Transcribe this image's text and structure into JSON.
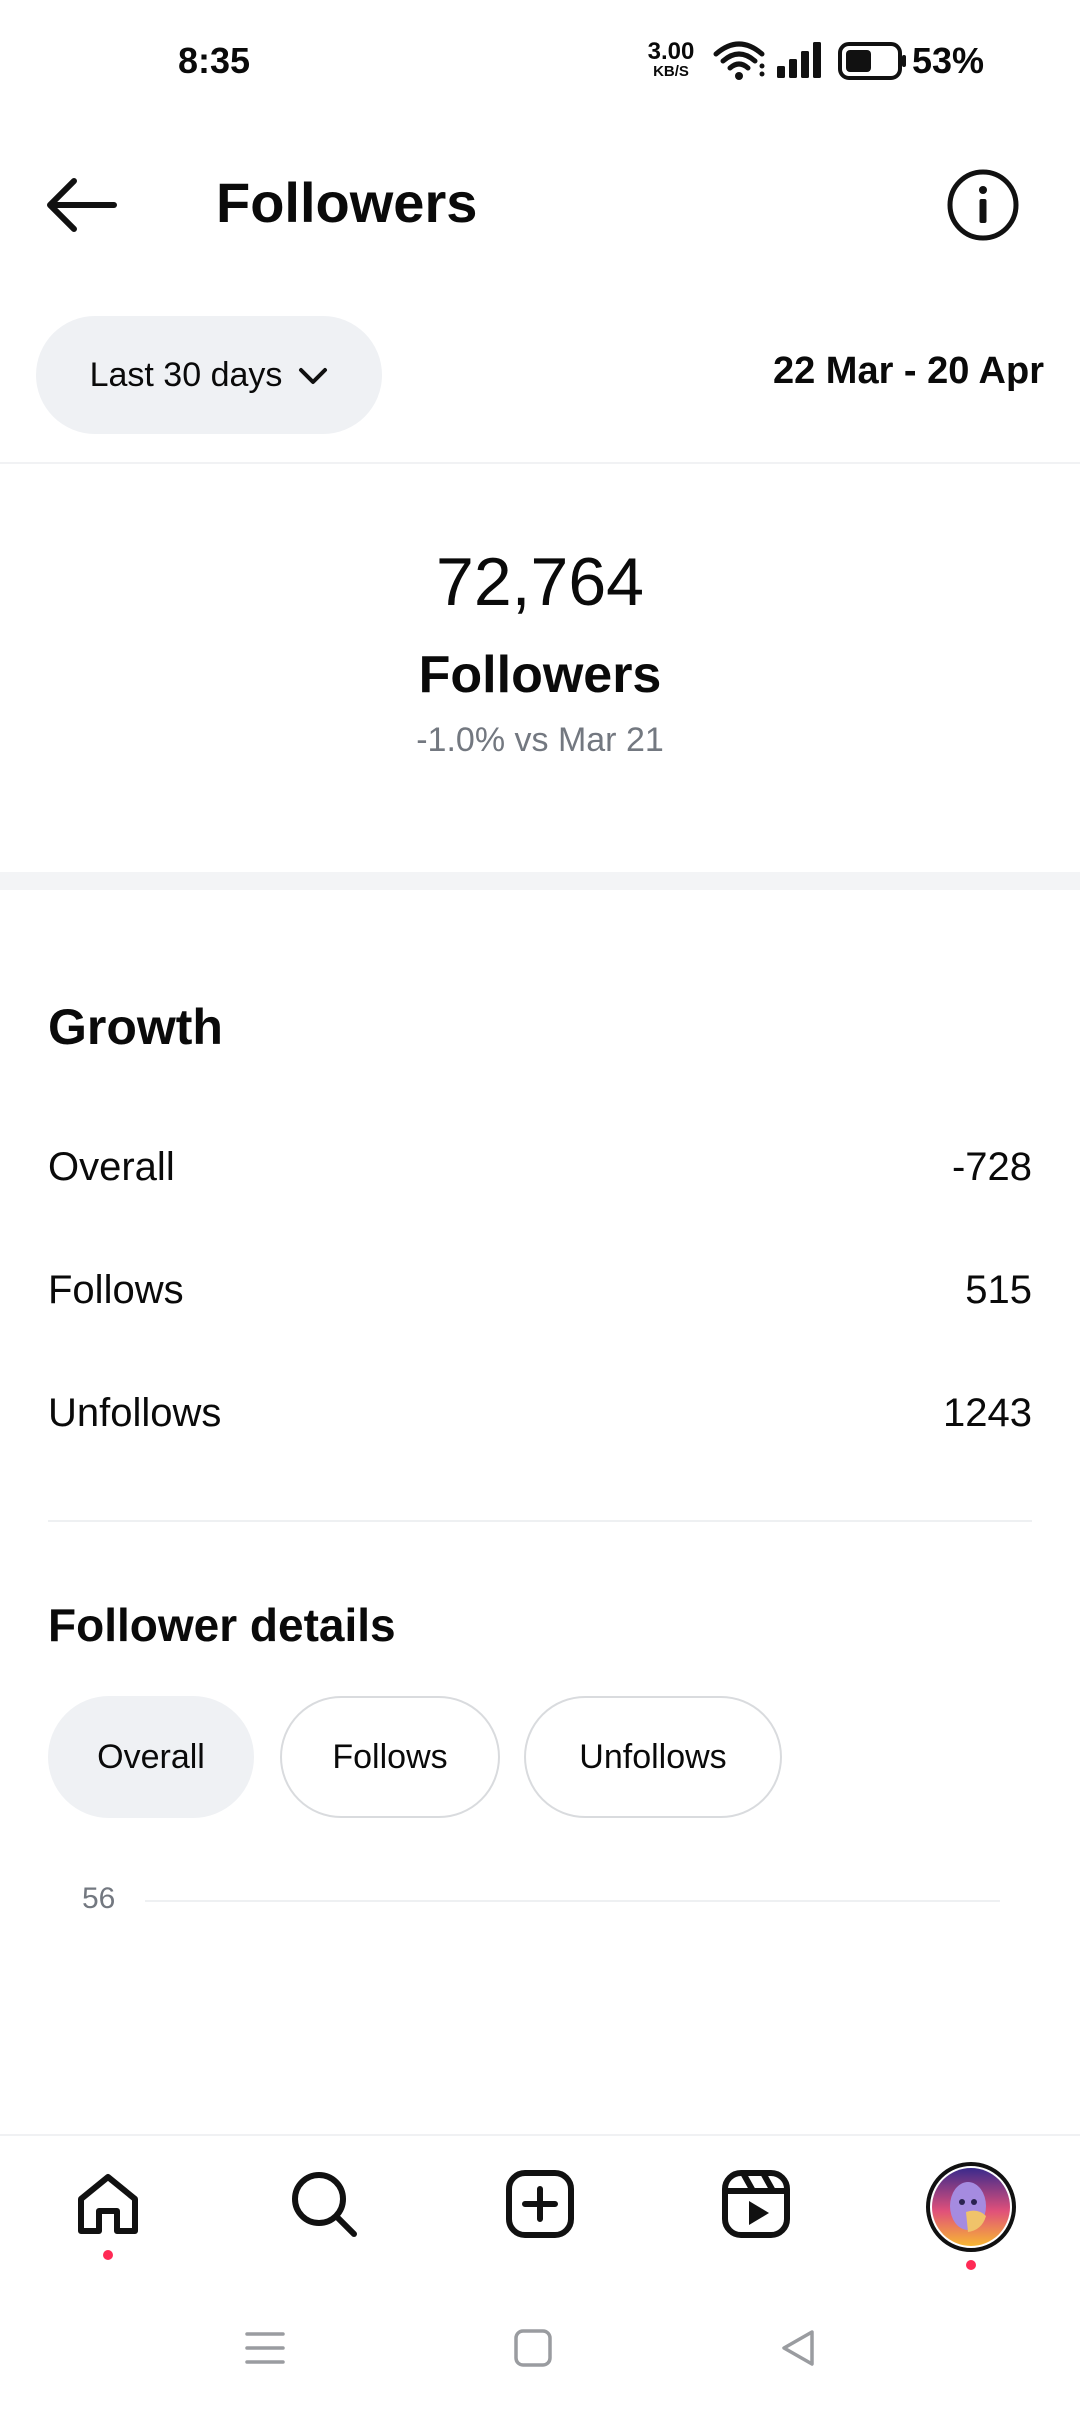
{
  "status_bar": {
    "time": "8:35",
    "net_speed_value": "3.00",
    "net_speed_unit": "KB/S",
    "battery_percent": "53%",
    "battery_level": 0.53
  },
  "header": {
    "title": "Followers",
    "back_icon": "arrow-left-icon",
    "info_icon": "info-icon"
  },
  "range": {
    "selector_label": "Last 30 days",
    "date_range": "22 Mar - 20 Apr"
  },
  "summary": {
    "total": "72,764",
    "label": "Followers",
    "change": "-1.0% vs Mar 21"
  },
  "growth": {
    "title": "Growth",
    "rows": [
      {
        "label": "Overall",
        "value": "-728"
      },
      {
        "label": "Follows",
        "value": "515"
      },
      {
        "label": "Unfollows",
        "value": "1243"
      }
    ]
  },
  "details": {
    "title": "Follower details",
    "chips": [
      {
        "label": "Overall",
        "active": true
      },
      {
        "label": "Follows",
        "active": false
      },
      {
        "label": "Unfollows",
        "active": false
      }
    ]
  },
  "chart_data": {
    "type": "line",
    "ytick_labels": [
      "56"
    ],
    "title": "",
    "xlabel": "",
    "ylabel": ""
  },
  "bottom_nav": {
    "items": [
      "home-icon",
      "search-icon",
      "create-icon",
      "reels-icon",
      "profile-avatar"
    ],
    "badge_color": "#ff2a55"
  },
  "system_nav": {
    "items": [
      "menu-icon",
      "home-square-icon",
      "back-triangle-icon"
    ]
  }
}
